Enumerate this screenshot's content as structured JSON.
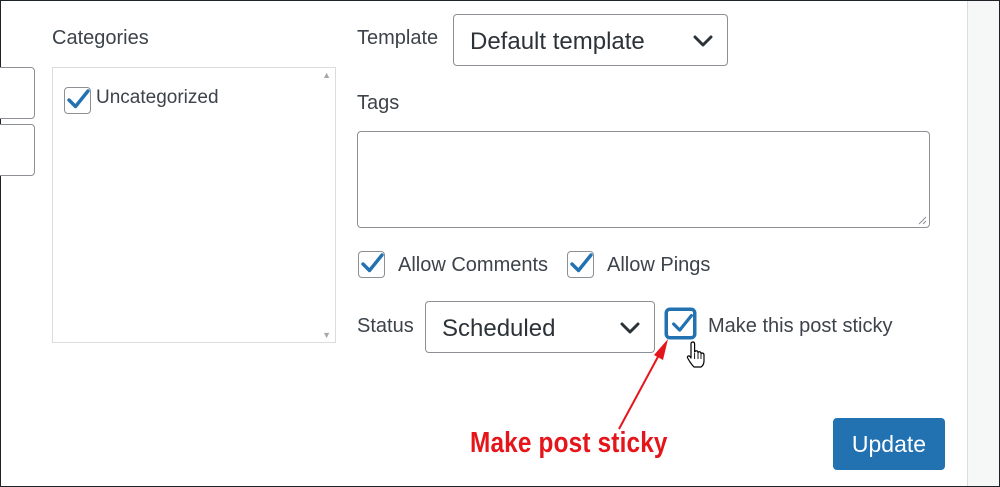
{
  "categories": {
    "heading": "Categories",
    "items": [
      {
        "label": "Uncategorized",
        "checked": true
      }
    ]
  },
  "template": {
    "label": "Template",
    "selected": "Default template"
  },
  "tags": {
    "label": "Tags",
    "value": ""
  },
  "discussion": {
    "allow_comments": {
      "label": "Allow Comments",
      "checked": true
    },
    "allow_pings": {
      "label": "Allow Pings",
      "checked": true
    }
  },
  "status": {
    "label": "Status",
    "selected": "Scheduled"
  },
  "sticky": {
    "label": "Make this post sticky",
    "checked": true
  },
  "update_button": {
    "label": "Update"
  },
  "annotation": {
    "text": "Make post sticky",
    "color": "#e5161b"
  },
  "colors": {
    "accent": "#2271b1",
    "annotation": "#e5161b"
  }
}
